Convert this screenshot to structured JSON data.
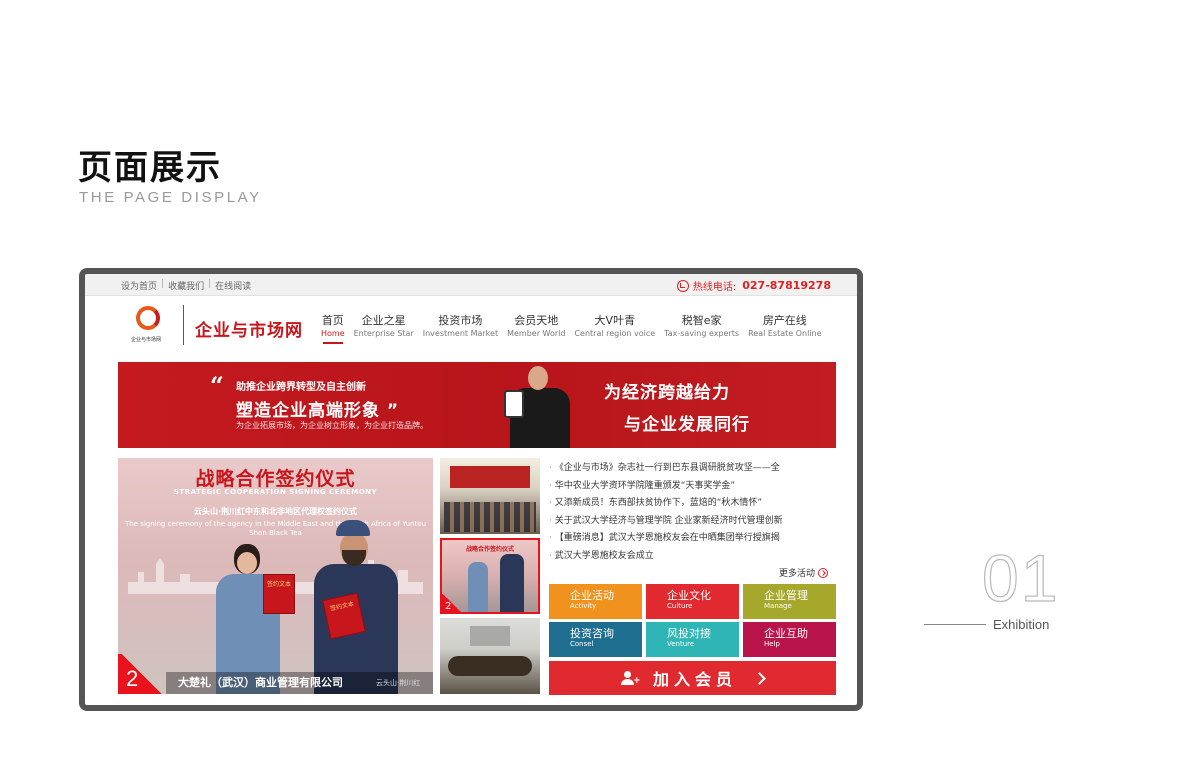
{
  "header": {
    "title": "页面展示",
    "subtitle": "THE PAGE DISPLAY"
  },
  "exhibit": {
    "number": "01",
    "label": "Exhibition"
  },
  "site": {
    "topbar": {
      "links": [
        "设为首页",
        "收藏我们",
        "在线阅读"
      ],
      "separator": "|",
      "hotline_label": "热线电话:",
      "hotline_number": "027-87819278"
    },
    "logo_small_text": "企业与市场网",
    "name": "企业与市场网",
    "nav": [
      {
        "cn": "首页",
        "en": "Home"
      },
      {
        "cn": "企业之星",
        "en": "Enterprise Star"
      },
      {
        "cn": "投资市场",
        "en": "Investment Market"
      },
      {
        "cn": "会员天地",
        "en": "Member World"
      },
      {
        "cn": "大V叶青",
        "en": "Central region voice"
      },
      {
        "cn": "税智e家",
        "en": "Tax-saving experts"
      },
      {
        "cn": "房产在线",
        "en": "Real Estate Online"
      }
    ],
    "banner": {
      "quote_open": "“",
      "quote_close": "”",
      "line1": "助推企业跨界转型及自主创新",
      "line2": "塑造企业高端形象",
      "line3": "为企业拓展市场，为企业树立形象，为企业打造品牌。",
      "slogan1": "为经济跨越给力",
      "slogan2": "与企业发展同行"
    },
    "feature": {
      "title": "战略合作签约仪式",
      "title_en": "STRATEGIC COOPERATION SIGNING CEREMONY",
      "subtitle_cn": "云头山·荆川红中东和北非地区代理权签约仪式",
      "subtitle_en": "The signing ceremony of the agency in the Middle East and the North Africa of Yuntou Shan Black Tea",
      "doc_text": "签约文本",
      "slide_number": "2",
      "caption": "大楚礼（武汉）商业管理有限公司",
      "caption_extra": "云头山·荆川红"
    },
    "thumbnails": [
      {
        "name": "conference-hall"
      },
      {
        "name": "signing-ceremony",
        "title": "战略合作签约仪式",
        "number": "2"
      },
      {
        "name": "meeting-room"
      }
    ],
    "news": [
      "《企业与市场》杂志社一行到巴东县调研脱贫攻坚——全",
      "华中农业大学资环学院隆重颁发“天事奖学金”",
      "又添新成员！东西部扶贫协作下，蓝焙的“秋木情怀”",
      "关于武汉大学经济与管理学院 企业家新经济时代管理创新",
      "【重磅消息】武汉大学恩施校友会在中晒集团举行授旗揭",
      "武汉大学恩施校友会成立"
    ],
    "more_label": "更多活动",
    "tiles": [
      {
        "cn": "企业活动",
        "en": "Activity",
        "color": "#f0921d"
      },
      {
        "cn": "企业文化",
        "en": "Culture",
        "color": "#e02a2f"
      },
      {
        "cn": "企业管理",
        "en": "Manage",
        "color": "#a5a82a"
      },
      {
        "cn": "投资咨询",
        "en": "Consel",
        "color": "#1e6f8f"
      },
      {
        "cn": "风投对接",
        "en": "Venture",
        "color": "#2fb5b5"
      },
      {
        "cn": "企业互助",
        "en": "Help",
        "color": "#b8134a"
      }
    ],
    "join_label": "加入会员"
  },
  "colors": {
    "brand_red": "#c8161d",
    "frame_gray": "#555555"
  }
}
